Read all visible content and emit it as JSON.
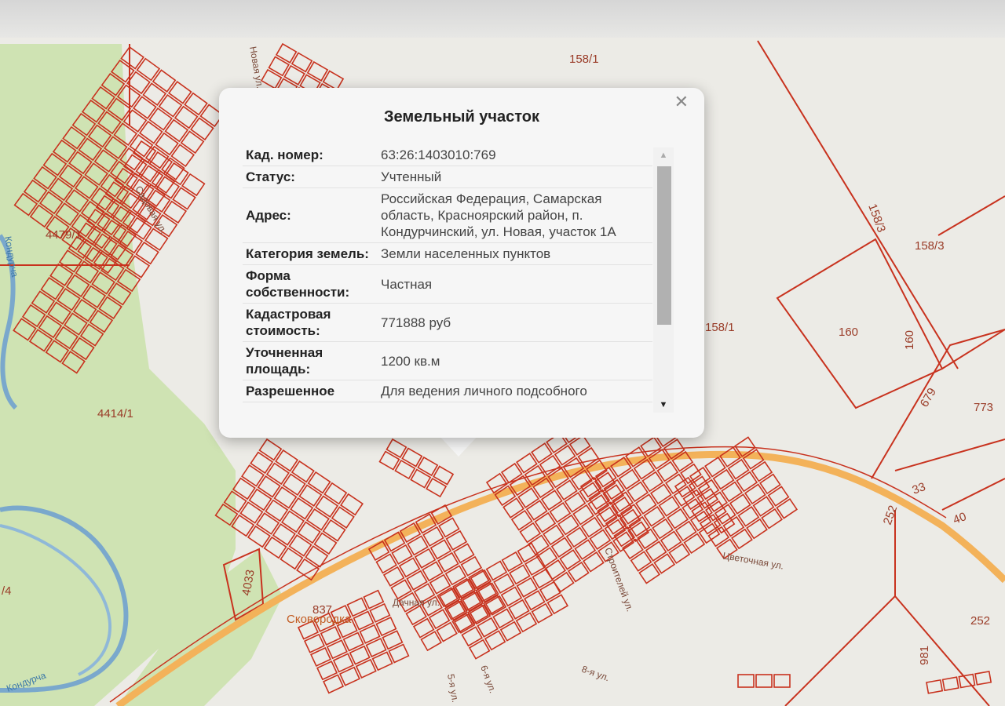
{
  "popup": {
    "title": "Земельный участок",
    "close_symbol": "✕",
    "fields": [
      {
        "key": "Кад. номер:",
        "value": "63:26:1403010:769"
      },
      {
        "key": "Статус:",
        "value": "Учтенный"
      },
      {
        "key": "Адрес:",
        "value": "Российская Федерация, Самарская область, Красноярский район, п. Кондурчинский, ул. Новая, участок 1А"
      },
      {
        "key": "Категория земель:",
        "value": "Земли населенных пунктов"
      },
      {
        "key": "Форма собственности:",
        "value": "Частная"
      },
      {
        "key": "Кадастровая стоимость:",
        "value": "771888 руб"
      },
      {
        "key": "Уточненная площадь:",
        "value": "1200 кв.м"
      },
      {
        "key": "Разрешенное",
        "value": "Для ведения личного подсобного"
      }
    ],
    "scroll_up_icon": "▲",
    "scroll_down_icon": "▼"
  },
  "map": {
    "parcel_labels": [
      "158/1",
      "158/1",
      "158/3",
      "158/3",
      "160",
      "160",
      "679",
      "773",
      "33",
      "40",
      "252",
      "252",
      "981",
      "4479/1",
      "4414/1",
      "4033",
      "837",
      "/4"
    ],
    "street_labels": [
      "Новая ул.",
      "Садовая ул.",
      "Дачная ул.",
      "Цветочная ул.",
      "Строителей ул.",
      "5-я ул.",
      "8-я ул.",
      "6-я ул."
    ],
    "village_label": "Сковородка",
    "river_labels": [
      "Кондурча",
      "Кондурча"
    ],
    "colors": {
      "parcel": "#c8321e",
      "green": "#cfe3b3",
      "road": "#f3b25a",
      "river": "#8fb8d8",
      "background": "#ecebe6"
    }
  }
}
